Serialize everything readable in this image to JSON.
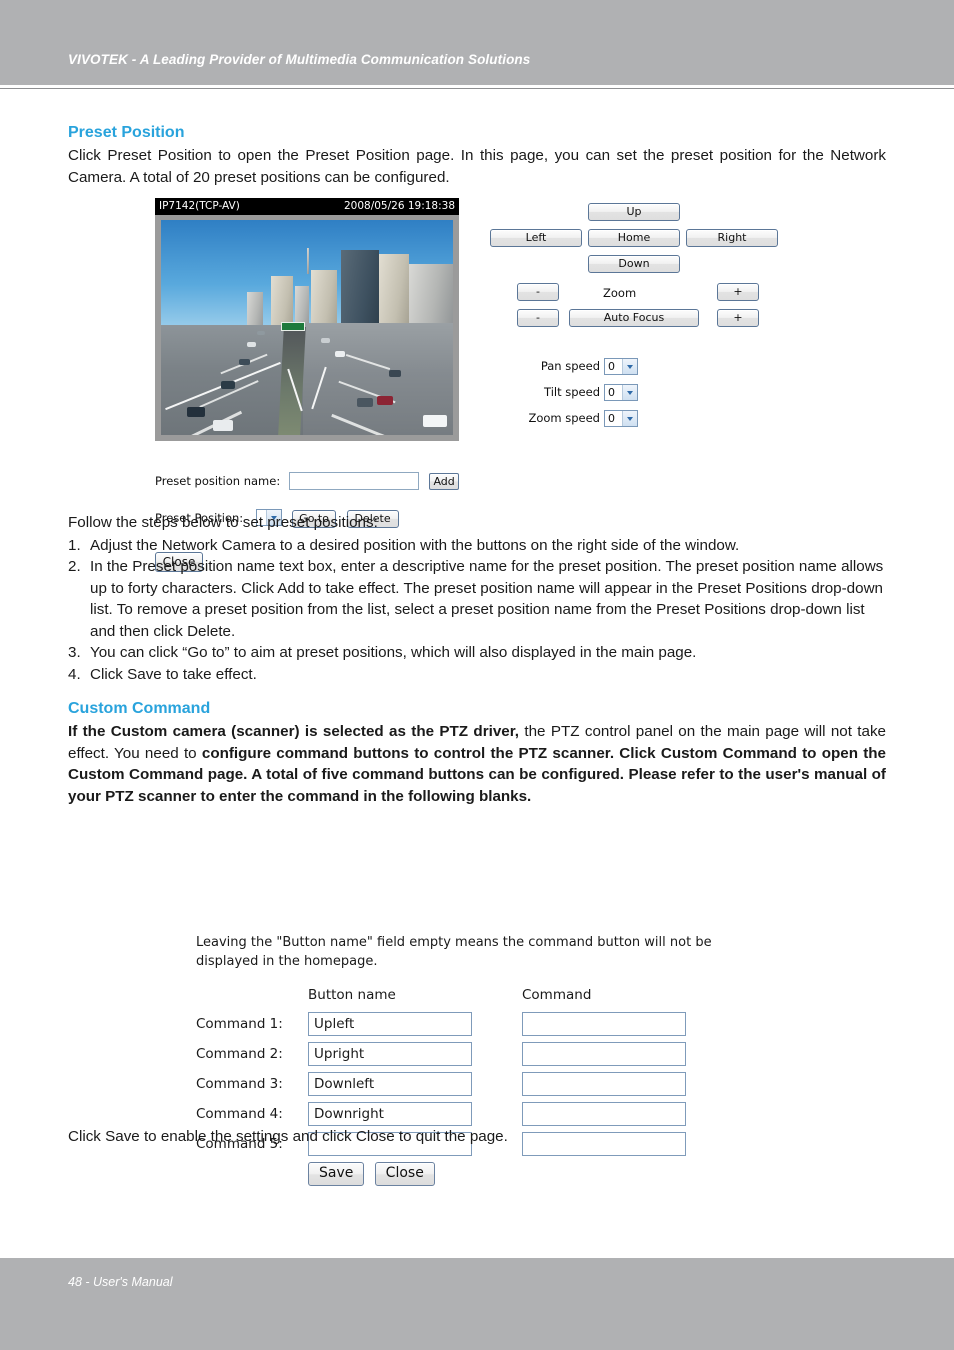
{
  "header": {
    "title": "VIVOTEK - A Leading Provider of Multimedia Communication Solutions",
    "band_color": "#b0b1b3"
  },
  "footer": {
    "text": "48 - User's Manual"
  },
  "accent_color": "#29a3dc",
  "preset_section": {
    "heading": "Preset Position",
    "intro": "Click Preset Position to open the Preset Position page. In this page, you can set the preset position for the Network Camera. A total of 20 preset positions can be configured.",
    "steps_intro": "Follow the steps below to set preset positions:",
    "steps": [
      {
        "num": "1.",
        "text": "Adjust the Network Camera to a desired position with the buttons on the right side of the window."
      },
      {
        "num": "2.",
        "text": "In the Preset position name text box, enter a descriptive name for the preset position. The preset position name allows up to forty characters. Click Add to take effect. The preset position name will appear in the Preset Positions drop-down list. To remove a preset position from the list, select a preset position name from the Preset Positions drop-down list and then click Delete."
      },
      {
        "num": "3.",
        "text": "You can click “Go to” to aim at preset positions, which will also displayed in the main page."
      },
      {
        "num": "4.",
        "text": "Click Save to take effect."
      }
    ]
  },
  "camera": {
    "stream_label": "IP7142(TCP-AV)",
    "timestamp": "2008/05/26 19:18:38"
  },
  "ptz": {
    "up": "Up",
    "left": "Left",
    "home": "Home",
    "right": "Right",
    "down": "Down",
    "zoom_label": "Zoom",
    "zoom_minus": "-",
    "zoom_plus": "+",
    "focus_minus": "-",
    "auto_focus": "Auto Focus",
    "focus_plus": "+",
    "speeds": [
      {
        "label": "Pan speed",
        "value": "0"
      },
      {
        "label": "Tilt speed",
        "value": "0"
      },
      {
        "label": "Zoom speed",
        "value": "0"
      }
    ]
  },
  "preset_form": {
    "name_label": "Preset position name:",
    "name_value": "",
    "add_button": "Add",
    "position_label": "Preset Position:",
    "position_value": "",
    "goto_button": "Go to",
    "delete_button": "Delete",
    "close_button": "Close"
  },
  "custom_section": {
    "heading": "Custom Command",
    "paragraph_parts": [
      {
        "text": "If the Custom camera (scanner) is selected as the PTZ driver,",
        "bold": true
      },
      {
        "text": " the PTZ control panel on the main page will not take effect. You need to ",
        "bold": false
      },
      {
        "text": "configure command buttons to control the PTZ scanner. Click Custom Command to open the Custom Command page. A total of five command buttons can be configured. Please refer to the user's manual of your PTZ scanner to enter the command in the following blanks.",
        "bold": true
      }
    ],
    "closing_text": "Click Save to enable the settings and click Close to quit the page."
  },
  "custom_form": {
    "note": "Leaving the \"Button name\" field empty means the command button will not be displayed in the homepage.",
    "col_button_name": "Button name",
    "col_command": "Command",
    "rows": [
      {
        "label": "Command 1:",
        "button_name": "Upleft",
        "command": ""
      },
      {
        "label": "Command 2:",
        "button_name": "Upright",
        "command": ""
      },
      {
        "label": "Command 3:",
        "button_name": "Downleft",
        "command": ""
      },
      {
        "label": "Command 4:",
        "button_name": "Downright",
        "command": ""
      },
      {
        "label": "Command 5:",
        "button_name": "",
        "command": ""
      }
    ],
    "save_button": "Save",
    "close_button": "Close"
  }
}
